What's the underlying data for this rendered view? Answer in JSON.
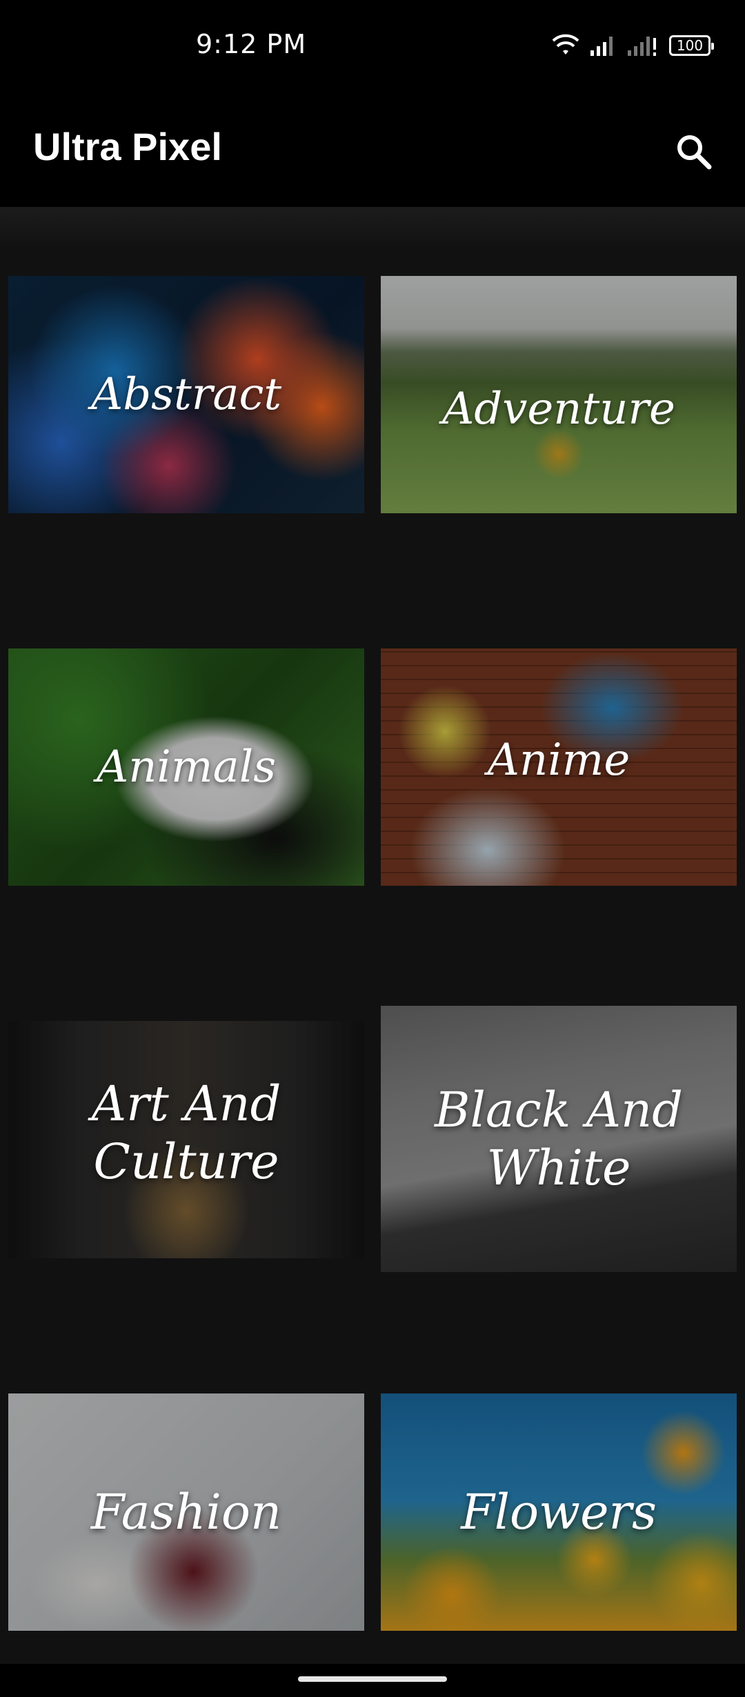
{
  "status_bar": {
    "time": "9:12 PM",
    "battery": "100",
    "icons": [
      "wifi-icon",
      "signal-icon",
      "signal-icon",
      "battery-icon"
    ]
  },
  "app_bar": {
    "title": "Ultra Pixel",
    "search_icon": "search-icon"
  },
  "categories": [
    {
      "label": "Abstract"
    },
    {
      "label": "Adventure"
    },
    {
      "label": "Animals"
    },
    {
      "label": "Anime"
    },
    {
      "label": "Art And Culture"
    },
    {
      "label": "Black And White"
    },
    {
      "label": "Fashion"
    },
    {
      "label": "Flowers"
    }
  ],
  "colors": {
    "background": "#111112",
    "app_bar": "#000000",
    "text": "#ffffff"
  }
}
